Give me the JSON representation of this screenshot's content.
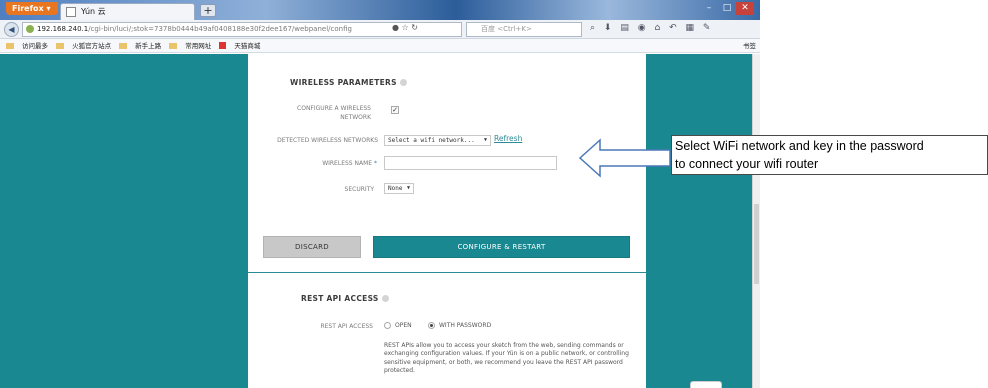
{
  "browser": {
    "app_label": "Firefox",
    "tab_title": "Yún 云",
    "new_tab_label": "+",
    "url_host": "192.168.240.1",
    "url_path": "/cgi-bin/luci/;stok=7378b0444b49af0408188e30f2dee167/webpanel/config",
    "search_placeholder": "百度 <Ctrl+K>",
    "window_controls": [
      "–",
      "□",
      "✕"
    ]
  },
  "bookmarks": {
    "items": [
      "访问最多",
      "火狐官方站点",
      "新手上路",
      "常用网址",
      "天猫商城"
    ],
    "right_label": "书签"
  },
  "wireless": {
    "section_title": "WIRELESS PARAMETERS",
    "configure_label": "CONFIGURE A WIRELESS NETWORK",
    "configure_checked": true,
    "detected_label": "DETECTED WIRELESS NETWORKS",
    "detected_select": "Select a wifi network...",
    "refresh_label": "Refresh",
    "name_label": "WIRELESS NAME",
    "name_required": "*",
    "name_value": "",
    "security_label": "SECURITY",
    "security_value": "None"
  },
  "buttons": {
    "discard": "DISCARD",
    "configure": "CONFIGURE & RESTART"
  },
  "rest_api": {
    "section_title": "REST API ACCESS",
    "label": "REST API ACCESS",
    "option_open": "OPEN",
    "option_password": "WITH PASSWORD",
    "selected": "WITH PASSWORD",
    "description": "REST APIs allow you to access your sketch from the web, sending commands or exchanging configuration values. If your Yún is on a public network, or controlling sensitive equipment, or both, we recommend you leave the REST API password protected."
  },
  "annotation": {
    "line1": "Select WiFi network and key in the password",
    "line2": "to connect your wifi router"
  },
  "colors": {
    "teal": "#1a8891",
    "link": "#2d8b95",
    "discard_bg": "#c8c8c8"
  }
}
